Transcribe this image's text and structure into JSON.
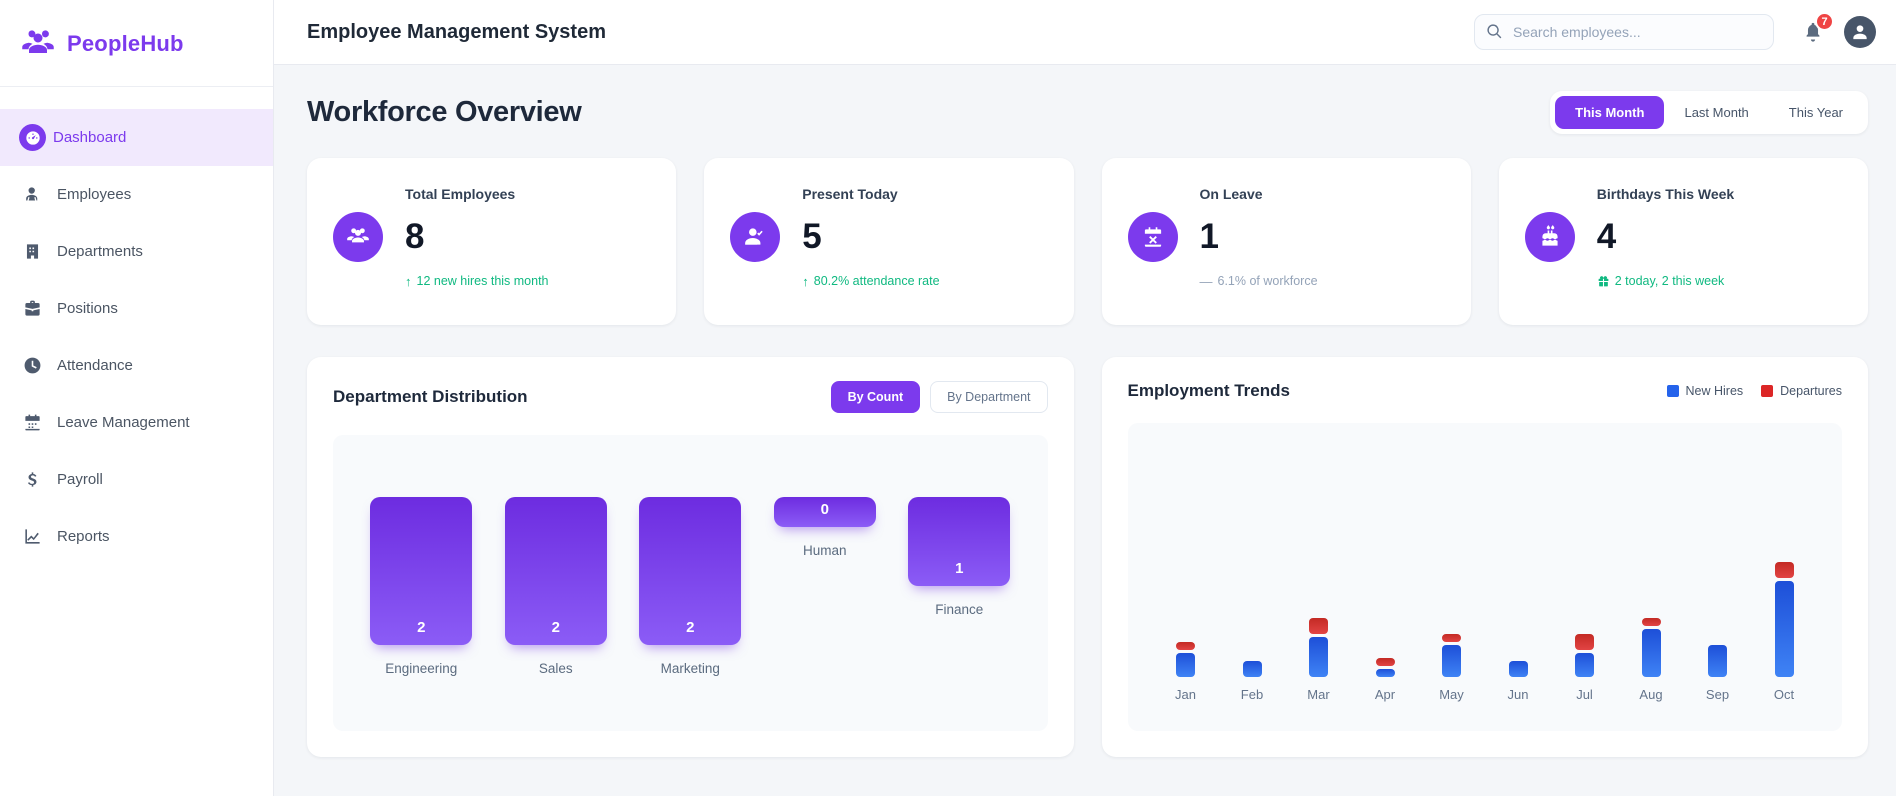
{
  "brand": {
    "name": "PeopleHub"
  },
  "sidebar": {
    "items": [
      {
        "label": "Dashboard",
        "active": true
      },
      {
        "label": "Employees",
        "active": false
      },
      {
        "label": "Departments",
        "active": false
      },
      {
        "label": "Positions",
        "active": false
      },
      {
        "label": "Attendance",
        "active": false
      },
      {
        "label": "Leave Management",
        "active": false
      },
      {
        "label": "Payroll",
        "active": false
      },
      {
        "label": "Reports",
        "active": false
      }
    ]
  },
  "header": {
    "title": "Employee Management System",
    "search_placeholder": "Search employees...",
    "notification_count": "7"
  },
  "page": {
    "title": "Workforce Overview",
    "range_tabs": [
      {
        "label": "This Month",
        "active": true
      },
      {
        "label": "Last Month",
        "active": false
      },
      {
        "label": "This Year",
        "active": false
      }
    ]
  },
  "stats": [
    {
      "label": "Total Employees",
      "value": "8",
      "sub": "12 new hires this month",
      "trend": "up",
      "icon": "users-icon"
    },
    {
      "label": "Present Today",
      "value": "5",
      "sub": "80.2% attendance rate",
      "trend": "up",
      "icon": "user-check-icon"
    },
    {
      "label": "On Leave",
      "value": "1",
      "sub": "6.1% of workforce",
      "trend": "neutral",
      "icon": "calendar-x-icon"
    },
    {
      "label": "Birthdays This Week",
      "value": "4",
      "sub": "2 today, 2 this week",
      "trend": "gift",
      "icon": "cake-icon"
    }
  ],
  "department_distribution": {
    "title": "Department Distribution",
    "toggles": [
      {
        "label": "By Count",
        "active": true
      },
      {
        "label": "By Department",
        "active": false
      }
    ],
    "chart_data": {
      "type": "bar",
      "categories": [
        "Engineering",
        "Sales",
        "Marketing",
        "Human",
        "Finance"
      ],
      "values": [
        2,
        2,
        2,
        0,
        1
      ],
      "title": "Department Distribution",
      "xlabel": "",
      "ylabel": "",
      "value_labels_on_bars": true,
      "bar_color": "#7c3aed",
      "grid": false
    }
  },
  "employment_trends": {
    "title": "Employment Trends",
    "chart_data": {
      "type": "bar",
      "stacked": true,
      "categories": [
        "Jan",
        "Feb",
        "Mar",
        "Apr",
        "May",
        "Jun",
        "Jul",
        "Aug",
        "Sep",
        "Oct"
      ],
      "series": [
        {
          "name": "New Hires",
          "color": "#2563eb",
          "values": [
            3,
            2,
            5,
            1,
            4,
            2,
            3,
            6,
            4,
            12
          ]
        },
        {
          "name": "Departures",
          "color": "#dc2626",
          "values": [
            1,
            0,
            2,
            1,
            1,
            0,
            2,
            1,
            0,
            2
          ]
        }
      ],
      "title": "Employment Trends",
      "legend_position": "top-right",
      "grid": false
    }
  },
  "colors": {
    "accent": "#7c3aed",
    "positive": "#10b981",
    "muted": "#94a3b8",
    "new_hires": "#2563eb",
    "departures": "#dc2626",
    "badge": "#ef4444"
  }
}
